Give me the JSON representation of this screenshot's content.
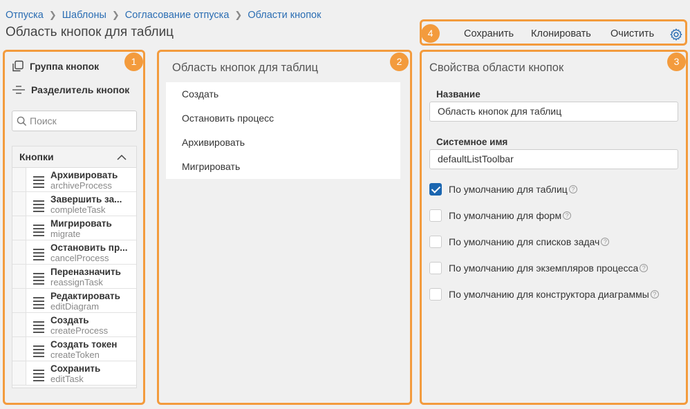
{
  "breadcrumb": [
    "Отпуска",
    "Шаблоны",
    "Согласование отпуска",
    "Области кнопок"
  ],
  "page_title": "Область кнопок для таблиц",
  "toolbar": {
    "save": "Сохранить",
    "clone": "Клонировать",
    "clear": "Очистить",
    "settings_icon": "gear-icon"
  },
  "badges": [
    "1",
    "2",
    "3",
    "4"
  ],
  "palette": {
    "group_label": "Группа кнопок",
    "separator_label": "Разделитель кнопок",
    "search_placeholder": "Поиск",
    "list_title": "Кнопки",
    "items": [
      {
        "name": "Архивировать",
        "code": "archiveProcess"
      },
      {
        "name": "Завершить за...",
        "code": "completeTask"
      },
      {
        "name": "Мигрировать",
        "code": "migrate"
      },
      {
        "name": "Остановить пр...",
        "code": "cancelProcess"
      },
      {
        "name": "Переназначить",
        "code": "reassignTask"
      },
      {
        "name": "Редактировать",
        "code": "editDiagram"
      },
      {
        "name": "Создать",
        "code": "createProcess"
      },
      {
        "name": "Создать токен",
        "code": "createToken"
      },
      {
        "name": "Сохранить",
        "code": "editTask"
      }
    ]
  },
  "canvas": {
    "title": "Область кнопок для таблиц",
    "items": [
      "Создать",
      "Остановить процесс",
      "Архивировать",
      "Мигрировать"
    ]
  },
  "properties": {
    "title": "Свойства области кнопок",
    "name_label": "Название",
    "name_value": "Область кнопок для таблиц",
    "sysname_label": "Системное имя",
    "sysname_value": "defaultListToolbar",
    "checkboxes": [
      {
        "label": "По умолчанию для таблиц",
        "checked": true
      },
      {
        "label": "По умолчанию для форм",
        "checked": false
      },
      {
        "label": "По умолчанию для списков задач",
        "checked": false
      },
      {
        "label": "По умолчанию для экземпляров процесса",
        "checked": false
      },
      {
        "label": "По умолчанию для конструктора диаграммы",
        "checked": false
      }
    ]
  },
  "colors": {
    "accent": "#f39b3d",
    "link": "#2a6db3",
    "checkbox": "#1b66b0"
  }
}
